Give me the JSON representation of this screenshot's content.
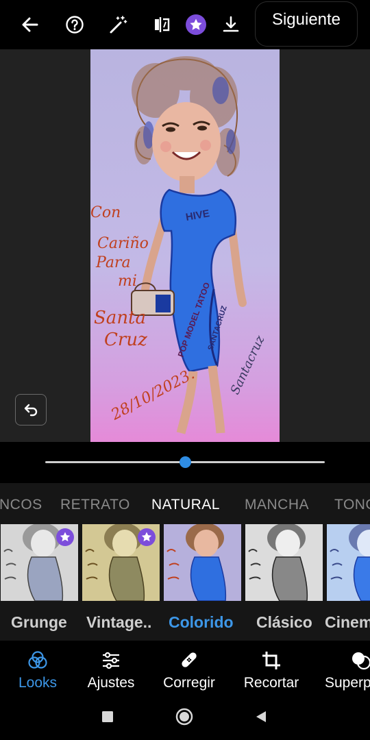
{
  "colors": {
    "accent_blue": "#3d97e8",
    "slider_knob": "#2f8de4",
    "premium_purple": "#7c4ddb",
    "canvas_bg": "#222222",
    "panel_bg": "#161616"
  },
  "topbar": {
    "icons": [
      "back-arrow-icon",
      "help-icon",
      "magic-wand-icon",
      "compare-icon",
      "premium-star-icon",
      "download-icon"
    ],
    "next_label": "Siguiente"
  },
  "canvas": {
    "art_text": {
      "left_lines": [
        "Con",
        "Cariño",
        "Para",
        "mi",
        "Santa",
        "Cruz"
      ],
      "date": "28/10/2023.",
      "dress_top": "HIVE",
      "dress_side": "POP MODEL TATOO",
      "dress_bottom": "SANTACRUZ",
      "signature": "Santacruz"
    }
  },
  "slider": {
    "value": 0.5
  },
  "categories": {
    "items": [
      "NCOS",
      "RETRATO",
      "NATURAL",
      "MANCHA",
      "TONO"
    ],
    "active": "NATURAL"
  },
  "looks": [
    {
      "label": "Grunge",
      "premium": true
    },
    {
      "label": "Vintage..",
      "premium": true
    },
    {
      "label": "Colorido",
      "premium": false,
      "selected": true
    },
    {
      "label": "Clásico",
      "premium": false
    },
    {
      "label": "Cinem",
      "premium": false
    }
  ],
  "bottom_nav": [
    {
      "label": "Looks",
      "icon": "looks-circles-icon",
      "active": true
    },
    {
      "label": "Ajustes",
      "icon": "sliders-icon"
    },
    {
      "label": "Corregir",
      "icon": "bandage-icon"
    },
    {
      "label": "Recortar",
      "icon": "crop-icon"
    },
    {
      "label": "Superp",
      "icon": "overlay-icon"
    }
  ],
  "system_nav": [
    "recents-square-icon",
    "home-circle-icon",
    "back-triangle-icon"
  ]
}
